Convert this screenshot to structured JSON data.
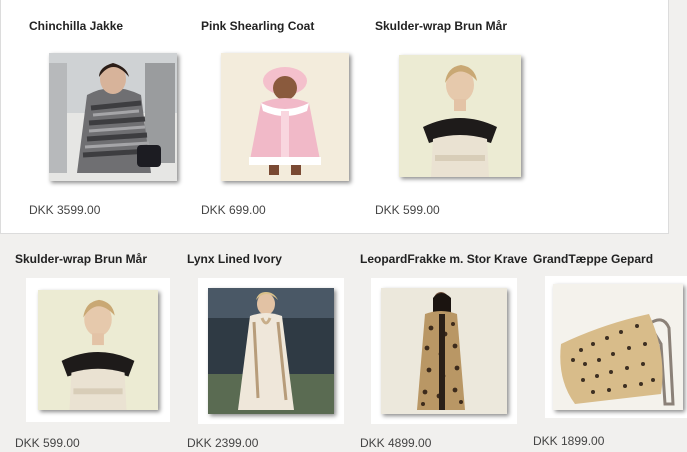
{
  "top_products": [
    {
      "name": "Chinchilla Jakke",
      "price": "DKK 3599.00",
      "image": "chinchilla-coat-photo"
    },
    {
      "name": "Pink Shearling Coat",
      "price": "DKK 699.00",
      "image": "pink-coat-photo"
    },
    {
      "name": "Skulder-wrap Brun Mår",
      "price": "DKK 599.00",
      "image": "shoulder-wrap-photo"
    }
  ],
  "bottom_products": [
    {
      "name": "Skulder-wrap Brun Mår",
      "price": "DKK 599.00",
      "image": "shoulder-wrap-photo"
    },
    {
      "name": "Lynx Lined Ivory",
      "price": "DKK 2399.00",
      "image": "ivory-coat-photo"
    },
    {
      "name": "LeopardFrakke m. Stor Krave",
      "price": "DKK 4899.00",
      "image": "leopard-coat-photo"
    },
    {
      "name": "GrandTæppe Gepard",
      "price": "DKK 1899.00",
      "image": "cheetah-throw-photo"
    }
  ],
  "colors": {
    "page_bg": "#f1f0ee",
    "panel_bg": "#ffffff",
    "text": "#222222"
  }
}
